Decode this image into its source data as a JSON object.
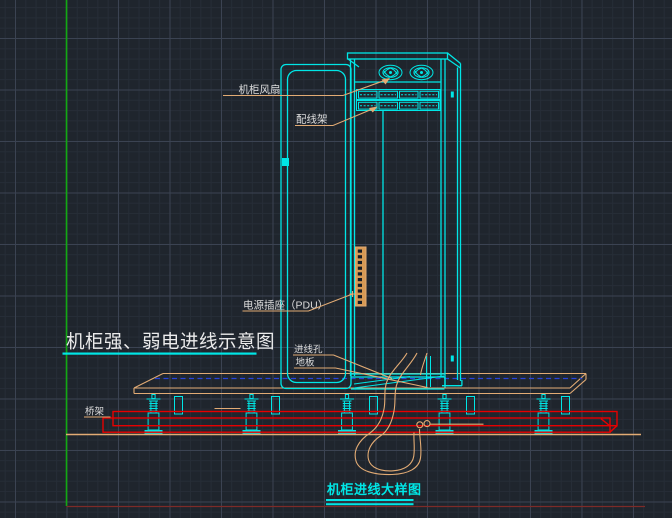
{
  "app": {
    "view": "cad-model-space"
  },
  "drawing": {
    "heading": "机柜强、弱电进线示意图",
    "title": "机柜进线大样图",
    "labels": {
      "fan": "机柜风扇",
      "patch_panel": "配线架",
      "pdu": "电源插座（PDU）",
      "entry_hole": "进线孔",
      "floor": "地板",
      "tray": "桥架"
    },
    "colors": {
      "background": "#1f252d",
      "grid_minor": "#262d37",
      "grid_major": "#3b4352",
      "cabinet_cyan": "#00e6e6",
      "leader_orange": "#e2ab74",
      "cable_tray_red": "#e60000",
      "axis_green": "#12a812",
      "border_dark_red": "#7d2b28",
      "route_blue_dashed": "#2743d9",
      "label_text": "#dcdcdc",
      "title_text": "#00e6e6"
    }
  }
}
